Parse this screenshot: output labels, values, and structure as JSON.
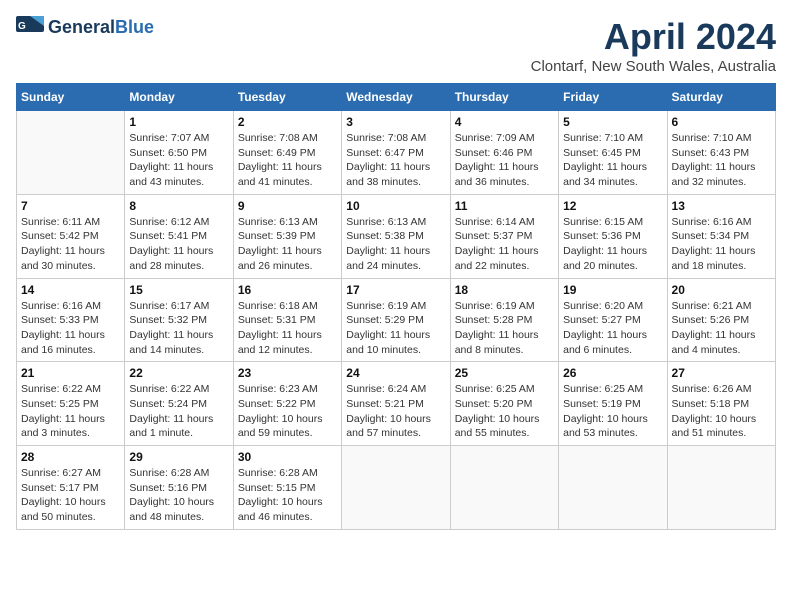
{
  "header": {
    "logo_general": "General",
    "logo_blue": "Blue",
    "month": "April 2024",
    "location": "Clontarf, New South Wales, Australia"
  },
  "weekdays": [
    "Sunday",
    "Monday",
    "Tuesday",
    "Wednesday",
    "Thursday",
    "Friday",
    "Saturday"
  ],
  "weeks": [
    [
      {
        "day": "",
        "info": ""
      },
      {
        "day": "1",
        "info": "Sunrise: 7:07 AM\nSunset: 6:50 PM\nDaylight: 11 hours\nand 43 minutes."
      },
      {
        "day": "2",
        "info": "Sunrise: 7:08 AM\nSunset: 6:49 PM\nDaylight: 11 hours\nand 41 minutes."
      },
      {
        "day": "3",
        "info": "Sunrise: 7:08 AM\nSunset: 6:47 PM\nDaylight: 11 hours\nand 38 minutes."
      },
      {
        "day": "4",
        "info": "Sunrise: 7:09 AM\nSunset: 6:46 PM\nDaylight: 11 hours\nand 36 minutes."
      },
      {
        "day": "5",
        "info": "Sunrise: 7:10 AM\nSunset: 6:45 PM\nDaylight: 11 hours\nand 34 minutes."
      },
      {
        "day": "6",
        "info": "Sunrise: 7:10 AM\nSunset: 6:43 PM\nDaylight: 11 hours\nand 32 minutes."
      }
    ],
    [
      {
        "day": "7",
        "info": "Sunrise: 6:11 AM\nSunset: 5:42 PM\nDaylight: 11 hours\nand 30 minutes."
      },
      {
        "day": "8",
        "info": "Sunrise: 6:12 AM\nSunset: 5:41 PM\nDaylight: 11 hours\nand 28 minutes."
      },
      {
        "day": "9",
        "info": "Sunrise: 6:13 AM\nSunset: 5:39 PM\nDaylight: 11 hours\nand 26 minutes."
      },
      {
        "day": "10",
        "info": "Sunrise: 6:13 AM\nSunset: 5:38 PM\nDaylight: 11 hours\nand 24 minutes."
      },
      {
        "day": "11",
        "info": "Sunrise: 6:14 AM\nSunset: 5:37 PM\nDaylight: 11 hours\nand 22 minutes."
      },
      {
        "day": "12",
        "info": "Sunrise: 6:15 AM\nSunset: 5:36 PM\nDaylight: 11 hours\nand 20 minutes."
      },
      {
        "day": "13",
        "info": "Sunrise: 6:16 AM\nSunset: 5:34 PM\nDaylight: 11 hours\nand 18 minutes."
      }
    ],
    [
      {
        "day": "14",
        "info": "Sunrise: 6:16 AM\nSunset: 5:33 PM\nDaylight: 11 hours\nand 16 minutes."
      },
      {
        "day": "15",
        "info": "Sunrise: 6:17 AM\nSunset: 5:32 PM\nDaylight: 11 hours\nand 14 minutes."
      },
      {
        "day": "16",
        "info": "Sunrise: 6:18 AM\nSunset: 5:31 PM\nDaylight: 11 hours\nand 12 minutes."
      },
      {
        "day": "17",
        "info": "Sunrise: 6:19 AM\nSunset: 5:29 PM\nDaylight: 11 hours\nand 10 minutes."
      },
      {
        "day": "18",
        "info": "Sunrise: 6:19 AM\nSunset: 5:28 PM\nDaylight: 11 hours\nand 8 minutes."
      },
      {
        "day": "19",
        "info": "Sunrise: 6:20 AM\nSunset: 5:27 PM\nDaylight: 11 hours\nand 6 minutes."
      },
      {
        "day": "20",
        "info": "Sunrise: 6:21 AM\nSunset: 5:26 PM\nDaylight: 11 hours\nand 4 minutes."
      }
    ],
    [
      {
        "day": "21",
        "info": "Sunrise: 6:22 AM\nSunset: 5:25 PM\nDaylight: 11 hours\nand 3 minutes."
      },
      {
        "day": "22",
        "info": "Sunrise: 6:22 AM\nSunset: 5:24 PM\nDaylight: 11 hours\nand 1 minute."
      },
      {
        "day": "23",
        "info": "Sunrise: 6:23 AM\nSunset: 5:22 PM\nDaylight: 10 hours\nand 59 minutes."
      },
      {
        "day": "24",
        "info": "Sunrise: 6:24 AM\nSunset: 5:21 PM\nDaylight: 10 hours\nand 57 minutes."
      },
      {
        "day": "25",
        "info": "Sunrise: 6:25 AM\nSunset: 5:20 PM\nDaylight: 10 hours\nand 55 minutes."
      },
      {
        "day": "26",
        "info": "Sunrise: 6:25 AM\nSunset: 5:19 PM\nDaylight: 10 hours\nand 53 minutes."
      },
      {
        "day": "27",
        "info": "Sunrise: 6:26 AM\nSunset: 5:18 PM\nDaylight: 10 hours\nand 51 minutes."
      }
    ],
    [
      {
        "day": "28",
        "info": "Sunrise: 6:27 AM\nSunset: 5:17 PM\nDaylight: 10 hours\nand 50 minutes."
      },
      {
        "day": "29",
        "info": "Sunrise: 6:28 AM\nSunset: 5:16 PM\nDaylight: 10 hours\nand 48 minutes."
      },
      {
        "day": "30",
        "info": "Sunrise: 6:28 AM\nSunset: 5:15 PM\nDaylight: 10 hours\nand 46 minutes."
      },
      {
        "day": "",
        "info": ""
      },
      {
        "day": "",
        "info": ""
      },
      {
        "day": "",
        "info": ""
      },
      {
        "day": "",
        "info": ""
      }
    ]
  ]
}
